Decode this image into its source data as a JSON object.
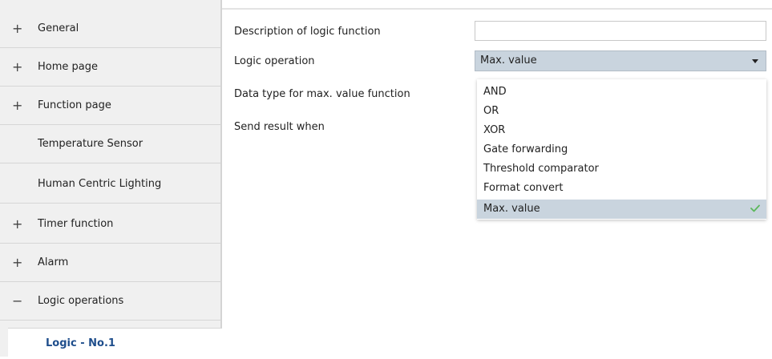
{
  "sidebar": {
    "items": [
      {
        "sign": "+",
        "label": "General"
      },
      {
        "sign": "+",
        "label": "Home page"
      },
      {
        "sign": "+",
        "label": "Function page"
      },
      {
        "sign": "",
        "label": "Temperature Sensor"
      },
      {
        "sign": "",
        "label": "Human Centric Lighting"
      },
      {
        "sign": "+",
        "label": "Timer function"
      },
      {
        "sign": "+",
        "label": "Alarm"
      },
      {
        "sign": "−",
        "label": "Logic operations"
      }
    ],
    "sub_item": {
      "label": "Logic  - No.1"
    }
  },
  "params": {
    "description_label": "Description of logic function",
    "description_value": "",
    "logic_operation_label": "Logic operation",
    "logic_operation_value": "Max. value",
    "data_type_label": "Data type for max. value function",
    "send_result_label": "Send result when"
  },
  "dropdown": {
    "options": [
      "AND",
      "OR",
      "XOR",
      "Gate forwarding",
      "Threshold comparator",
      "Format convert",
      "Max. value"
    ],
    "selected": "Max. value"
  },
  "colors": {
    "selected_bg": "#c9d4de",
    "check": "#5cb85c",
    "sub_item_text": "#1f4e8c"
  }
}
